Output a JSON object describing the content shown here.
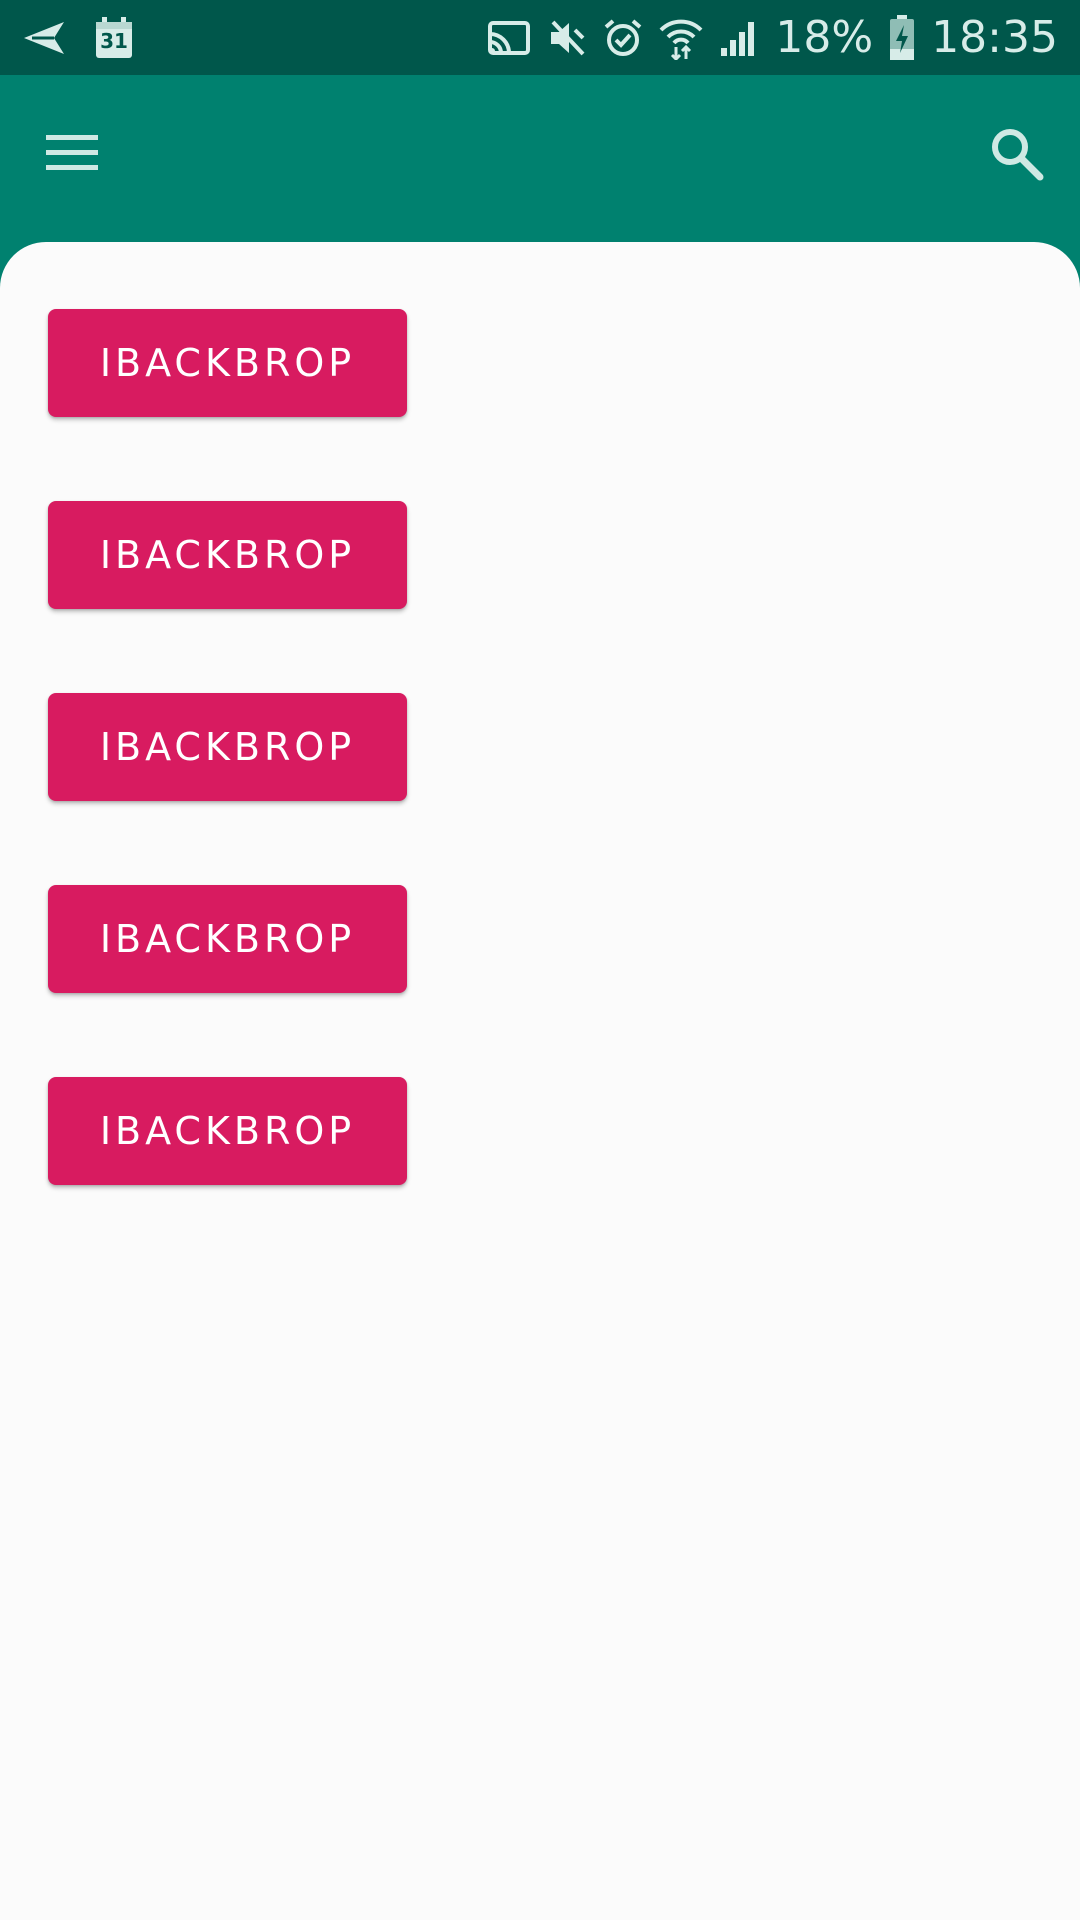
{
  "status_bar": {
    "battery": "18%",
    "time": "18:35",
    "calendar_day": "31",
    "icons": [
      "send-icon",
      "calendar-icon",
      "cast-icon",
      "mute-icon",
      "alarm-icon",
      "wifi-icon",
      "signal-icon",
      "battery-charging-icon"
    ]
  },
  "app_bar": {
    "menu_icon": "menu-icon",
    "search_icon": "search-icon",
    "color": "#00816f"
  },
  "content": {
    "buttons": [
      {
        "label": "IBACKBROP"
      },
      {
        "label": "IBACKBROP"
      },
      {
        "label": "IBACKBROP"
      },
      {
        "label": "IBACKBROP"
      },
      {
        "label": "IBACKBROP"
      }
    ],
    "button_color": "#d81b60",
    "background": "#fbfbfb"
  }
}
